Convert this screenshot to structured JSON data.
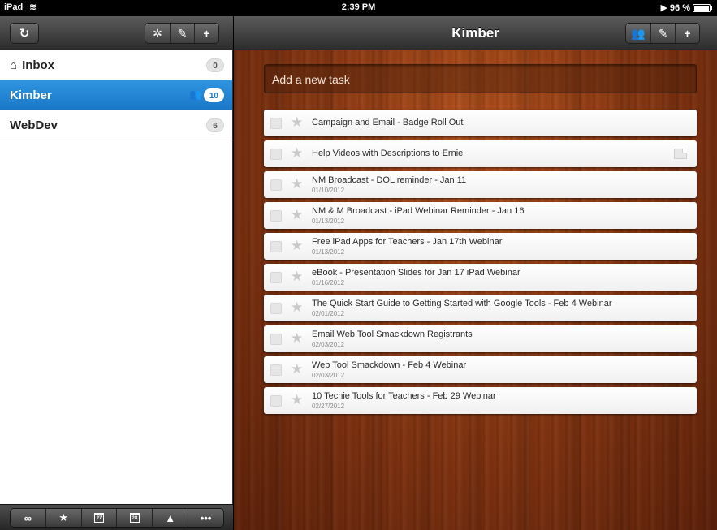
{
  "status_bar": {
    "carrier": "iPad",
    "time": "2:39 PM",
    "battery": "96 %"
  },
  "sidebar": {
    "toolbar": {
      "refresh_icon": "refresh-icon",
      "settings_icon": "gear-icon",
      "edit_icon": "pencil-icon",
      "add_icon": "plus-icon"
    },
    "lists": [
      {
        "name": "Inbox",
        "count": "0",
        "icon": "inbox-icon"
      },
      {
        "name": "Kimber",
        "count": "10",
        "icon": "shared-users-icon"
      },
      {
        "name": "WebDev",
        "count": "6"
      }
    ],
    "footer_icons": [
      "infinity-icon",
      "star-icon",
      "calendar-27-icon",
      "calendar-28-icon",
      "warning-icon",
      "more-icon"
    ],
    "footer_cal1": "27",
    "footer_cal2": "28",
    "footer_more": "•••"
  },
  "main": {
    "title": "Kimber",
    "add_task_placeholder": "Add a new task",
    "tasks": [
      {
        "title": "Campaign and Email - Badge Roll Out",
        "date": ""
      },
      {
        "title": "Help Videos with Descriptions to Ernie",
        "date": "",
        "has_note": true
      },
      {
        "title": "NM Broadcast - DOL reminder - Jan 11",
        "date": "01/10/2012"
      },
      {
        "title": "NM & M Broadcast - iPad Webinar Reminder - Jan 16",
        "date": "01/13/2012"
      },
      {
        "title": "Free iPad Apps for Teachers - Jan 17th Webinar",
        "date": "01/13/2012"
      },
      {
        "title": "eBook - Presentation Slides for Jan 17 iPad Webinar",
        "date": "01/16/2012"
      },
      {
        "title": "The Quick Start Guide to Getting Started with Google Tools - Feb 4 Webinar",
        "date": "02/01/2012"
      },
      {
        "title": "Email Web Tool Smackdown Registrants",
        "date": "02/03/2012"
      },
      {
        "title": "Web Tool Smackdown - Feb 4 Webinar",
        "date": "02/03/2012"
      },
      {
        "title": "10 Techie Tools for Teachers - Feb 29 Webinar",
        "date": "02/27/2012"
      }
    ]
  },
  "colors": {
    "selection": "#1f80d0",
    "toolbar": "#3a3a3a",
    "wood": "#8d3a13"
  }
}
